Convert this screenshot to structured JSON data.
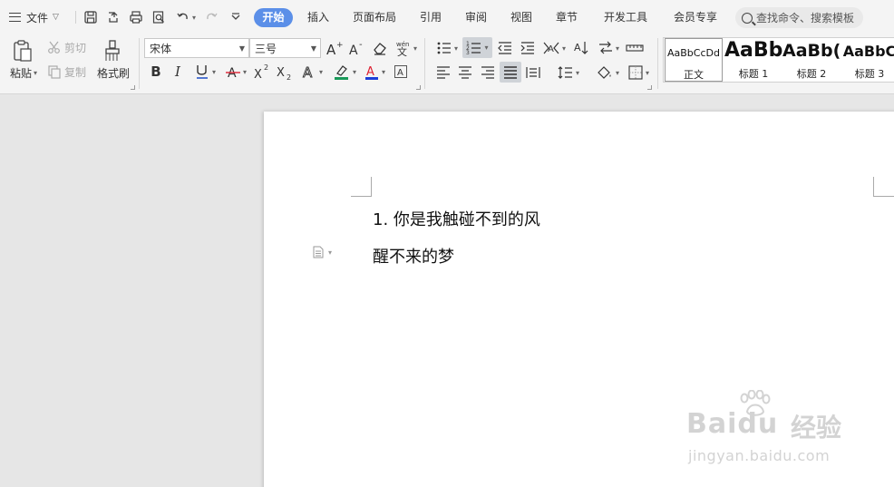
{
  "menubar": {
    "file_label": "文件",
    "tabs": [
      {
        "label": "开始",
        "active": true
      },
      {
        "label": "插入"
      },
      {
        "label": "页面布局"
      },
      {
        "label": "引用"
      },
      {
        "label": "审阅"
      },
      {
        "label": "视图"
      },
      {
        "label": "章节"
      },
      {
        "label": "开发工具"
      },
      {
        "label": "会员专享"
      }
    ],
    "search_placeholder": "查找命令、搜索模板"
  },
  "ribbon": {
    "clipboard": {
      "paste": "粘贴",
      "cut": "剪切",
      "copy": "复制",
      "format_painter": "格式刷"
    },
    "font": {
      "name": "宋体",
      "size": "三号"
    },
    "styles": [
      {
        "sample": "AaBbCcDd",
        "name": "正文"
      },
      {
        "sample": "AaBb",
        "name": "标题 1"
      },
      {
        "sample": "AaBb(",
        "name": "标题 2"
      },
      {
        "sample": "AaBbC",
        "name": "标题 3"
      }
    ]
  },
  "document": {
    "lines": [
      "1. 你是我触碰不到的风",
      "醒不来的梦"
    ]
  },
  "watermark": {
    "brand": "Baidu",
    "cn": "经验",
    "url": "jingyan.baidu.com"
  },
  "colors": {
    "accent": "#5b8fe8",
    "highlight_bar": "#1a9a5a",
    "font_color_bar": "#1d3fd8",
    "font_color_a": "#d23"
  }
}
